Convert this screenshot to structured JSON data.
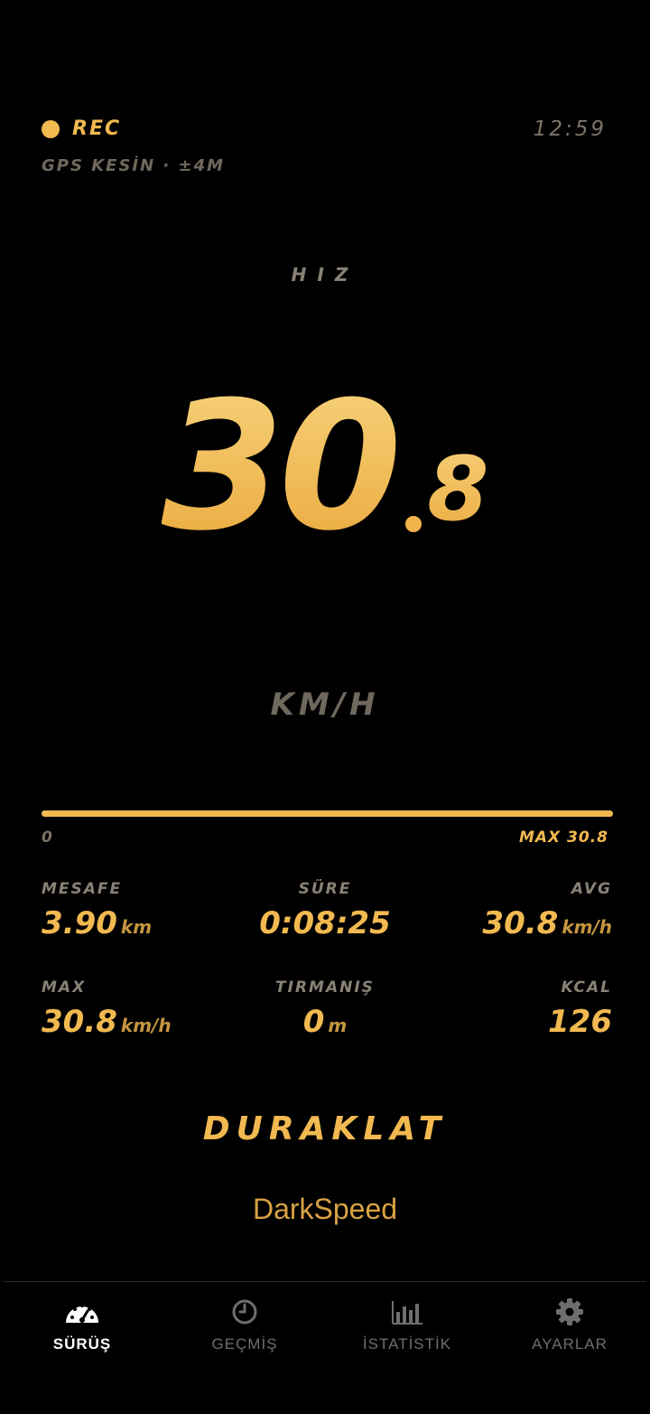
{
  "status": {
    "rec_label": "REC",
    "clock": "12:59",
    "gps": "GPS KESİN · ±4M"
  },
  "speed": {
    "label": "HIZ",
    "integer": "30",
    "decimal": "8",
    "unit": "KM/H"
  },
  "progress": {
    "fraction": 1.0,
    "min_label": "0",
    "max_label": "MAX 30.8"
  },
  "stats": [
    {
      "label": "MESAFE",
      "value": "3.90",
      "unit": "km"
    },
    {
      "label": "SÜRE",
      "value": "0:08:25",
      "unit": ""
    },
    {
      "label": "AVG",
      "value": "30.8",
      "unit": "km/h"
    },
    {
      "label": "MAX",
      "value": "30.8",
      "unit": "km/h"
    },
    {
      "label": "TIRMANIŞ",
      "value": "0",
      "unit": "m"
    },
    {
      "label": "KCAL",
      "value": "126",
      "unit": ""
    }
  ],
  "actions": {
    "pause_label": "DURAKLAT"
  },
  "brand": "DarkSpeed",
  "nav": [
    {
      "label": "SÜRÜŞ",
      "icon": "speedometer-icon",
      "active": true
    },
    {
      "label": "GEÇMİŞ",
      "icon": "clock-icon",
      "active": false
    },
    {
      "label": "İSTATİSTİK",
      "icon": "bar-chart-icon",
      "active": false
    },
    {
      "label": "AYARLAR",
      "icon": "gear-icon",
      "active": false
    }
  ],
  "colors": {
    "accent": "#f2b950",
    "muted": "#6f685d",
    "background": "#000000",
    "nav_active": "#ffffff",
    "nav_inactive": "#6e6e6e"
  }
}
